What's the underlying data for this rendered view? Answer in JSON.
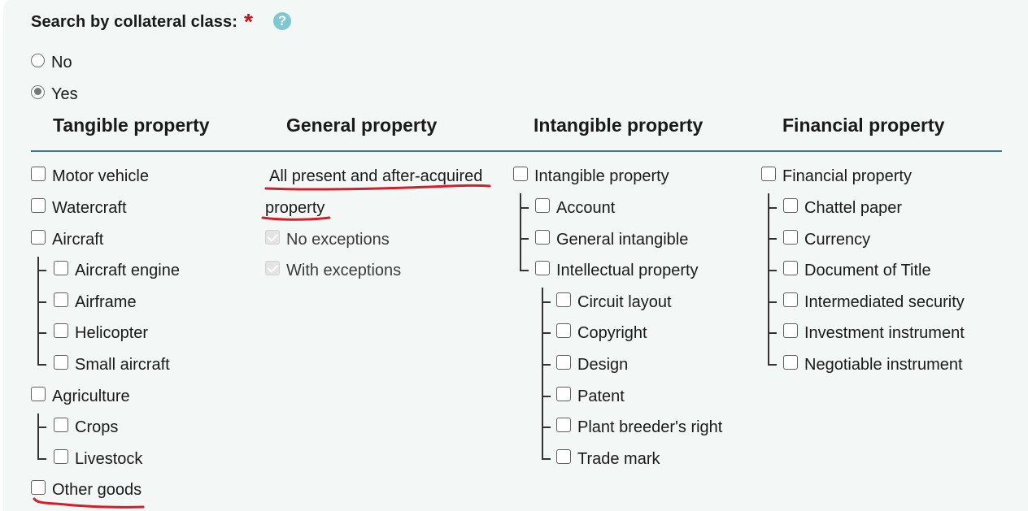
{
  "question": {
    "label": "Search by collateral class:",
    "required_mark": "*",
    "help_icon": "?"
  },
  "radio_options": [
    {
      "label": "No",
      "checked": false
    },
    {
      "label": "Yes",
      "checked": true
    }
  ],
  "columns": {
    "tangible": {
      "heading": "Tangible property",
      "items": {
        "motor_vehicle": "Motor vehicle",
        "watercraft": "Watercraft",
        "aircraft": "Aircraft",
        "aircraft_engine": "Aircraft engine",
        "airframe": "Airframe",
        "helicopter": "Helicopter",
        "small_aircraft": "Small aircraft",
        "agriculture": "Agriculture",
        "crops": "Crops",
        "livestock": "Livestock",
        "other_goods": "Other goods"
      }
    },
    "general": {
      "heading": "General property",
      "items": {
        "all_present_line1": "All present and after-acquired",
        "all_present_line2": "property",
        "no_exceptions": "No exceptions",
        "with_exceptions": "With exceptions"
      }
    },
    "intangible": {
      "heading": "Intangible property",
      "items": {
        "intangible_property": "Intangible property",
        "account": "Account",
        "general_intangible": "General intangible",
        "intellectual_property": "Intellectual property",
        "circuit_layout": "Circuit layout",
        "copyright": "Copyright",
        "design": "Design",
        "patent": "Patent",
        "plant_breeders_right": "Plant breeder's right",
        "trade_mark": "Trade mark"
      }
    },
    "financial": {
      "heading": "Financial property",
      "items": {
        "financial_property": "Financial property",
        "chattel_paper": "Chattel paper",
        "currency": "Currency",
        "document_of_title": "Document of Title",
        "intermediated_security": "Intermediated security",
        "investment_instrument": "Investment instrument",
        "negotiable_instrument": "Negotiable instrument"
      }
    }
  },
  "colors": {
    "panel_bg": "#f3f7f6",
    "divider": "#3d7a82",
    "required": "#c0171b",
    "help": "#7fc8d2",
    "annotation": "#d21f2a"
  }
}
